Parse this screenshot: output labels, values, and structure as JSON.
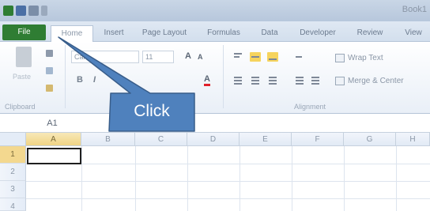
{
  "window": {
    "title": "Book1",
    "qat_icons": [
      "excel-app-icon",
      "save-icon",
      "undo-icon",
      "redo-icon"
    ]
  },
  "tabs": [
    {
      "label": "File"
    },
    {
      "label": "Home"
    },
    {
      "label": "Insert"
    },
    {
      "label": "Page Layout"
    },
    {
      "label": "Formulas"
    },
    {
      "label": "Data"
    },
    {
      "label": "Developer"
    },
    {
      "label": "Review"
    },
    {
      "label": "View"
    }
  ],
  "ribbon": {
    "clipboard": {
      "paste_label": "Paste",
      "group_label": "Clipboard"
    },
    "font": {
      "font_name": "Cal",
      "font_size": "11",
      "bold": "B",
      "italic": "I",
      "grow": "A",
      "shrink": "A",
      "font_color": "A"
    },
    "alignment": {
      "wrap_text": "Wrap Text",
      "merge_center": "Merge & Center",
      "group_label": "Alignment"
    }
  },
  "formula_bar": {
    "name_box": "A1"
  },
  "sheet": {
    "columns": [
      "A",
      "B",
      "C",
      "D",
      "E",
      "F",
      "G",
      "H"
    ],
    "rows": [
      "1",
      "2",
      "3",
      "4"
    ],
    "active_cell": "A1"
  },
  "callout": {
    "text": "Click"
  },
  "colors": {
    "file_tab": "#2f7d33",
    "callout_fill": "#4f81bd",
    "callout_border": "#385d8a",
    "selection": "#f3d88f"
  }
}
